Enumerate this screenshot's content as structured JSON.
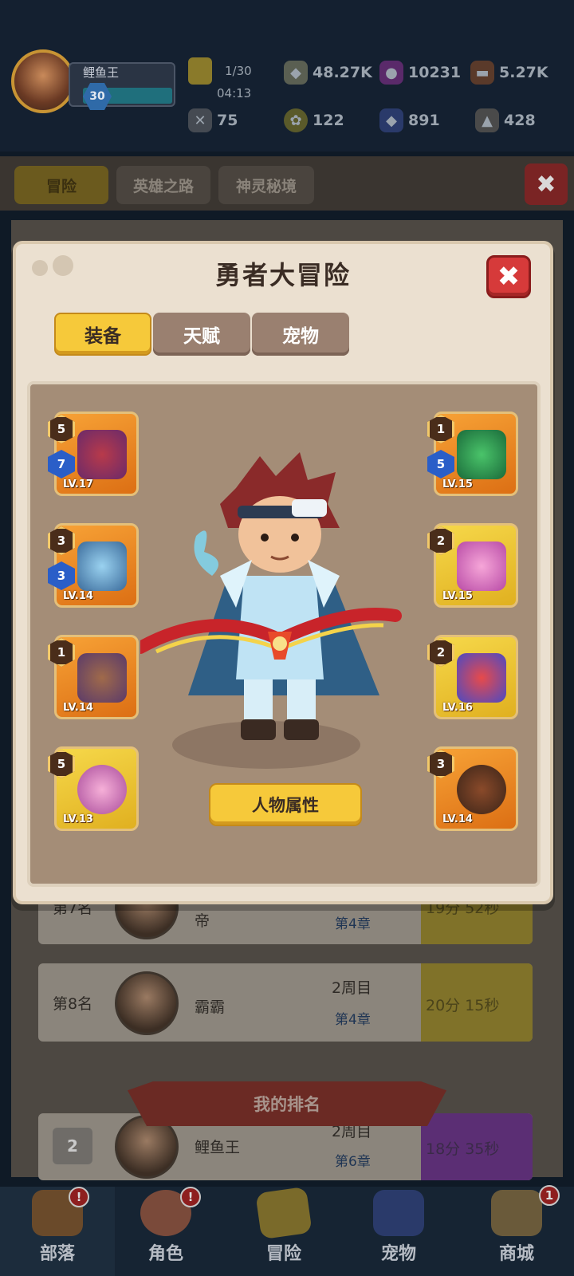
{
  "hud": {
    "player_name": "鲤鱼王",
    "player_level": "30",
    "energy_count": "1/30",
    "energy_timer": "04:13",
    "resources": [
      {
        "name": "coin-icon",
        "value": "48.27K"
      },
      {
        "name": "gem-icon",
        "value": "10231"
      },
      {
        "name": "wood-icon",
        "value": "5.27K"
      },
      {
        "name": "bone-icon",
        "value": "75"
      },
      {
        "name": "leaf-token-icon",
        "value": "122"
      },
      {
        "name": "crystal-icon",
        "value": "891"
      },
      {
        "name": "ore-icon",
        "value": "428"
      }
    ]
  },
  "navtabs": [
    "冒险",
    "英雄之路",
    "神灵秘境"
  ],
  "rankings": [
    {
      "rank": "第7名",
      "name": "帝",
      "week": "",
      "chapter": "第4章",
      "time": "19分 52秒"
    },
    {
      "rank": "第8名",
      "name": "霸霸",
      "week": "2周目",
      "chapter": "第4章",
      "time": "20分 15秒"
    }
  ],
  "my_rank": {
    "title": "我的排名",
    "rank": "2",
    "name": "鲤鱼王",
    "week": "2周目",
    "chapter": "第6章",
    "time": "18分 35秒"
  },
  "bottom_nav": [
    {
      "label": "部落",
      "badge": "!"
    },
    {
      "label": "角色",
      "badge": "!"
    },
    {
      "label": "冒险",
      "badge": ""
    },
    {
      "label": "宠物",
      "badge": ""
    },
    {
      "label": "商城",
      "badge": "1"
    }
  ],
  "modal": {
    "title": "勇者大冒险",
    "tabs": [
      "装备",
      "天赋",
      "宠物"
    ],
    "attr_button": "人物属性",
    "left_slots": [
      {
        "name": "weapon-bow-slot",
        "stars": "5",
        "gems": "7",
        "level": "LV.17",
        "color": "orange"
      },
      {
        "name": "armor-slot",
        "stars": "3",
        "gems": "3",
        "level": "LV.14",
        "color": "orange"
      },
      {
        "name": "pants-slot",
        "stars": "1",
        "gems": "",
        "level": "LV.14",
        "color": "orange"
      },
      {
        "name": "ring-slot",
        "stars": "5",
        "gems": "",
        "level": "LV.13",
        "color": "yellow"
      }
    ],
    "right_slots": [
      {
        "name": "helmet-slot",
        "stars": "1",
        "gems": "5",
        "level": "LV.15",
        "color": "orange"
      },
      {
        "name": "gloves-slot",
        "stars": "2",
        "gems": "",
        "level": "LV.15",
        "color": "yellow"
      },
      {
        "name": "boots-slot",
        "stars": "2",
        "gems": "",
        "level": "LV.16",
        "color": "yellow"
      },
      {
        "name": "amulet-slot",
        "stars": "3",
        "gems": "",
        "level": "LV.14",
        "color": "orange"
      }
    ]
  },
  "colors": {
    "accent": "#f6c93a",
    "close": "#d63a3a",
    "slot_orange": "#f08a22",
    "slot_yellow": "#f0c832"
  }
}
